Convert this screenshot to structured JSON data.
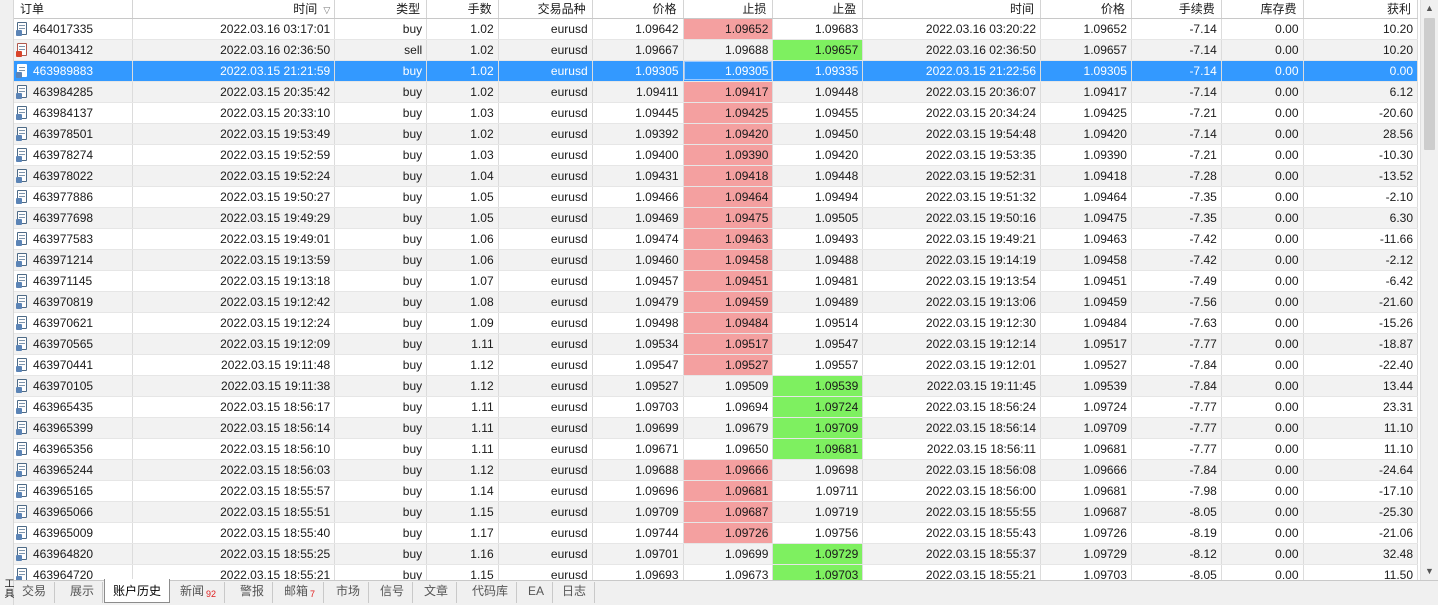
{
  "side_label": "工具箱",
  "columns": [
    "订单",
    "时间",
    "类型",
    "手数",
    "交易品种",
    "价格",
    "止损",
    "止盈",
    "时间",
    "价格",
    "手续费",
    "库存费",
    "获利"
  ],
  "rows": [
    {
      "order": "464017335",
      "open_time": "2022.03.16 03:17:01",
      "type": "buy",
      "lots": "1.02",
      "symbol": "eurusd",
      "open_price": "1.09642",
      "sl": "1.09652",
      "tp": "1.09683",
      "close_time": "2022.03.16 03:20:22",
      "close_price": "1.09652",
      "commission": "-7.14",
      "swap": "0.00",
      "profit": "10.20",
      "hit": "sl"
    },
    {
      "order": "464013412",
      "open_time": "2022.03.16 02:36:50",
      "type": "sell",
      "lots": "1.02",
      "symbol": "eurusd",
      "open_price": "1.09667",
      "sl": "1.09688",
      "tp": "1.09657",
      "close_time": "2022.03.16 02:36:50",
      "close_price": "1.09657",
      "commission": "-7.14",
      "swap": "0.00",
      "profit": "10.20",
      "hit": "tp"
    },
    {
      "order": "463989883",
      "open_time": "2022.03.15 21:21:59",
      "type": "buy",
      "lots": "1.02",
      "symbol": "eurusd",
      "open_price": "1.09305",
      "sl": "1.09305",
      "tp": "1.09335",
      "close_time": "2022.03.15 21:22:56",
      "close_price": "1.09305",
      "commission": "-7.14",
      "swap": "0.00",
      "profit": "0.00",
      "hit": "sl",
      "selected": true
    },
    {
      "order": "463984285",
      "open_time": "2022.03.15 20:35:42",
      "type": "buy",
      "lots": "1.02",
      "symbol": "eurusd",
      "open_price": "1.09411",
      "sl": "1.09417",
      "tp": "1.09448",
      "close_time": "2022.03.15 20:36:07",
      "close_price": "1.09417",
      "commission": "-7.14",
      "swap": "0.00",
      "profit": "6.12",
      "hit": "sl"
    },
    {
      "order": "463984137",
      "open_time": "2022.03.15 20:33:10",
      "type": "buy",
      "lots": "1.03",
      "symbol": "eurusd",
      "open_price": "1.09445",
      "sl": "1.09425",
      "tp": "1.09455",
      "close_time": "2022.03.15 20:34:24",
      "close_price": "1.09425",
      "commission": "-7.21",
      "swap": "0.00",
      "profit": "-20.60",
      "hit": "sl"
    },
    {
      "order": "463978501",
      "open_time": "2022.03.15 19:53:49",
      "type": "buy",
      "lots": "1.02",
      "symbol": "eurusd",
      "open_price": "1.09392",
      "sl": "1.09420",
      "tp": "1.09450",
      "close_time": "2022.03.15 19:54:48",
      "close_price": "1.09420",
      "commission": "-7.14",
      "swap": "0.00",
      "profit": "28.56",
      "hit": "sl"
    },
    {
      "order": "463978274",
      "open_time": "2022.03.15 19:52:59",
      "type": "buy",
      "lots": "1.03",
      "symbol": "eurusd",
      "open_price": "1.09400",
      "sl": "1.09390",
      "tp": "1.09420",
      "close_time": "2022.03.15 19:53:35",
      "close_price": "1.09390",
      "commission": "-7.21",
      "swap": "0.00",
      "profit": "-10.30",
      "hit": "sl"
    },
    {
      "order": "463978022",
      "open_time": "2022.03.15 19:52:24",
      "type": "buy",
      "lots": "1.04",
      "symbol": "eurusd",
      "open_price": "1.09431",
      "sl": "1.09418",
      "tp": "1.09448",
      "close_time": "2022.03.15 19:52:31",
      "close_price": "1.09418",
      "commission": "-7.28",
      "swap": "0.00",
      "profit": "-13.52",
      "hit": "sl"
    },
    {
      "order": "463977886",
      "open_time": "2022.03.15 19:50:27",
      "type": "buy",
      "lots": "1.05",
      "symbol": "eurusd",
      "open_price": "1.09466",
      "sl": "1.09464",
      "tp": "1.09494",
      "close_time": "2022.03.15 19:51:32",
      "close_price": "1.09464",
      "commission": "-7.35",
      "swap": "0.00",
      "profit": "-2.10",
      "hit": "sl"
    },
    {
      "order": "463977698",
      "open_time": "2022.03.15 19:49:29",
      "type": "buy",
      "lots": "1.05",
      "symbol": "eurusd",
      "open_price": "1.09469",
      "sl": "1.09475",
      "tp": "1.09505",
      "close_time": "2022.03.15 19:50:16",
      "close_price": "1.09475",
      "commission": "-7.35",
      "swap": "0.00",
      "profit": "6.30",
      "hit": "sl"
    },
    {
      "order": "463977583",
      "open_time": "2022.03.15 19:49:01",
      "type": "buy",
      "lots": "1.06",
      "symbol": "eurusd",
      "open_price": "1.09474",
      "sl": "1.09463",
      "tp": "1.09493",
      "close_time": "2022.03.15 19:49:21",
      "close_price": "1.09463",
      "commission": "-7.42",
      "swap": "0.00",
      "profit": "-11.66",
      "hit": "sl"
    },
    {
      "order": "463971214",
      "open_time": "2022.03.15 19:13:59",
      "type": "buy",
      "lots": "1.06",
      "symbol": "eurusd",
      "open_price": "1.09460",
      "sl": "1.09458",
      "tp": "1.09488",
      "close_time": "2022.03.15 19:14:19",
      "close_price": "1.09458",
      "commission": "-7.42",
      "swap": "0.00",
      "profit": "-2.12",
      "hit": "sl"
    },
    {
      "order": "463971145",
      "open_time": "2022.03.15 19:13:18",
      "type": "buy",
      "lots": "1.07",
      "symbol": "eurusd",
      "open_price": "1.09457",
      "sl": "1.09451",
      "tp": "1.09481",
      "close_time": "2022.03.15 19:13:54",
      "close_price": "1.09451",
      "commission": "-7.49",
      "swap": "0.00",
      "profit": "-6.42",
      "hit": "sl"
    },
    {
      "order": "463970819",
      "open_time": "2022.03.15 19:12:42",
      "type": "buy",
      "lots": "1.08",
      "symbol": "eurusd",
      "open_price": "1.09479",
      "sl": "1.09459",
      "tp": "1.09489",
      "close_time": "2022.03.15 19:13:06",
      "close_price": "1.09459",
      "commission": "-7.56",
      "swap": "0.00",
      "profit": "-21.60",
      "hit": "sl"
    },
    {
      "order": "463970621",
      "open_time": "2022.03.15 19:12:24",
      "type": "buy",
      "lots": "1.09",
      "symbol": "eurusd",
      "open_price": "1.09498",
      "sl": "1.09484",
      "tp": "1.09514",
      "close_time": "2022.03.15 19:12:30",
      "close_price": "1.09484",
      "commission": "-7.63",
      "swap": "0.00",
      "profit": "-15.26",
      "hit": "sl"
    },
    {
      "order": "463970565",
      "open_time": "2022.03.15 19:12:09",
      "type": "buy",
      "lots": "1.11",
      "symbol": "eurusd",
      "open_price": "1.09534",
      "sl": "1.09517",
      "tp": "1.09547",
      "close_time": "2022.03.15 19:12:14",
      "close_price": "1.09517",
      "commission": "-7.77",
      "swap": "0.00",
      "profit": "-18.87",
      "hit": "sl"
    },
    {
      "order": "463970441",
      "open_time": "2022.03.15 19:11:48",
      "type": "buy",
      "lots": "1.12",
      "symbol": "eurusd",
      "open_price": "1.09547",
      "sl": "1.09527",
      "tp": "1.09557",
      "close_time": "2022.03.15 19:12:01",
      "close_price": "1.09527",
      "commission": "-7.84",
      "swap": "0.00",
      "profit": "-22.40",
      "hit": "sl"
    },
    {
      "order": "463970105",
      "open_time": "2022.03.15 19:11:38",
      "type": "buy",
      "lots": "1.12",
      "symbol": "eurusd",
      "open_price": "1.09527",
      "sl": "1.09509",
      "tp": "1.09539",
      "close_time": "2022.03.15 19:11:45",
      "close_price": "1.09539",
      "commission": "-7.84",
      "swap": "0.00",
      "profit": "13.44",
      "hit": "tp"
    },
    {
      "order": "463965435",
      "open_time": "2022.03.15 18:56:17",
      "type": "buy",
      "lots": "1.11",
      "symbol": "eurusd",
      "open_price": "1.09703",
      "sl": "1.09694",
      "tp": "1.09724",
      "close_time": "2022.03.15 18:56:24",
      "close_price": "1.09724",
      "commission": "-7.77",
      "swap": "0.00",
      "profit": "23.31",
      "hit": "tp"
    },
    {
      "order": "463965399",
      "open_time": "2022.03.15 18:56:14",
      "type": "buy",
      "lots": "1.11",
      "symbol": "eurusd",
      "open_price": "1.09699",
      "sl": "1.09679",
      "tp": "1.09709",
      "close_time": "2022.03.15 18:56:14",
      "close_price": "1.09709",
      "commission": "-7.77",
      "swap": "0.00",
      "profit": "11.10",
      "hit": "tp"
    },
    {
      "order": "463965356",
      "open_time": "2022.03.15 18:56:10",
      "type": "buy",
      "lots": "1.11",
      "symbol": "eurusd",
      "open_price": "1.09671",
      "sl": "1.09650",
      "tp": "1.09681",
      "close_time": "2022.03.15 18:56:11",
      "close_price": "1.09681",
      "commission": "-7.77",
      "swap": "0.00",
      "profit": "11.10",
      "hit": "tp"
    },
    {
      "order": "463965244",
      "open_time": "2022.03.15 18:56:03",
      "type": "buy",
      "lots": "1.12",
      "symbol": "eurusd",
      "open_price": "1.09688",
      "sl": "1.09666",
      "tp": "1.09698",
      "close_time": "2022.03.15 18:56:08",
      "close_price": "1.09666",
      "commission": "-7.84",
      "swap": "0.00",
      "profit": "-24.64",
      "hit": "sl"
    },
    {
      "order": "463965165",
      "open_time": "2022.03.15 18:55:57",
      "type": "buy",
      "lots": "1.14",
      "symbol": "eurusd",
      "open_price": "1.09696",
      "sl": "1.09681",
      "tp": "1.09711",
      "close_time": "2022.03.15 18:56:00",
      "close_price": "1.09681",
      "commission": "-7.98",
      "swap": "0.00",
      "profit": "-17.10",
      "hit": "sl"
    },
    {
      "order": "463965066",
      "open_time": "2022.03.15 18:55:51",
      "type": "buy",
      "lots": "1.15",
      "symbol": "eurusd",
      "open_price": "1.09709",
      "sl": "1.09687",
      "tp": "1.09719",
      "close_time": "2022.03.15 18:55:55",
      "close_price": "1.09687",
      "commission": "-8.05",
      "swap": "0.00",
      "profit": "-25.30",
      "hit": "sl"
    },
    {
      "order": "463965009",
      "open_time": "2022.03.15 18:55:40",
      "type": "buy",
      "lots": "1.17",
      "symbol": "eurusd",
      "open_price": "1.09744",
      "sl": "1.09726",
      "tp": "1.09756",
      "close_time": "2022.03.15 18:55:43",
      "close_price": "1.09726",
      "commission": "-8.19",
      "swap": "0.00",
      "profit": "-21.06",
      "hit": "sl"
    },
    {
      "order": "463964820",
      "open_time": "2022.03.15 18:55:25",
      "type": "buy",
      "lots": "1.16",
      "symbol": "eurusd",
      "open_price": "1.09701",
      "sl": "1.09699",
      "tp": "1.09729",
      "close_time": "2022.03.15 18:55:37",
      "close_price": "1.09729",
      "commission": "-8.12",
      "swap": "0.00",
      "profit": "32.48",
      "hit": "tp"
    },
    {
      "order": "463964720",
      "open_time": "2022.03.15 18:55:21",
      "type": "buy",
      "lots": "1.15",
      "symbol": "eurusd",
      "open_price": "1.09693",
      "sl": "1.09673",
      "tp": "1.09703",
      "close_time": "2022.03.15 18:55:21",
      "close_price": "1.09703",
      "commission": "-8.05",
      "swap": "0.00",
      "profit": "11.50",
      "hit": "tp"
    }
  ],
  "tabs": [
    {
      "id": "trade",
      "label": "交易"
    },
    {
      "id": "exposure",
      "label": "展示"
    },
    {
      "id": "history",
      "label": "账户历史",
      "active": true
    },
    {
      "id": "news",
      "label": "新闻",
      "count": "92"
    },
    {
      "id": "alerts",
      "label": "警报"
    },
    {
      "id": "mailbox",
      "label": "邮箱",
      "count": "7"
    },
    {
      "id": "market",
      "label": "市场"
    },
    {
      "id": "signals",
      "label": "信号"
    },
    {
      "id": "articles",
      "label": "文章"
    },
    {
      "id": "codebase",
      "label": "代码库"
    },
    {
      "id": "ea",
      "label": "EA"
    },
    {
      "id": "journal",
      "label": "日志"
    }
  ],
  "colors": {
    "selection": "#3399ff",
    "stop_loss_hit": "#f4a0a0",
    "take_profit_hit": "#7ef060",
    "alt_row": "#f2f2f2",
    "tab_badge": "#e02020"
  },
  "icons": {
    "order": "order-document-icon",
    "sort": "sort-descending-icon",
    "scroll_up": "scroll-up-arrow-icon",
    "scroll_down": "scroll-down-arrow-icon"
  }
}
